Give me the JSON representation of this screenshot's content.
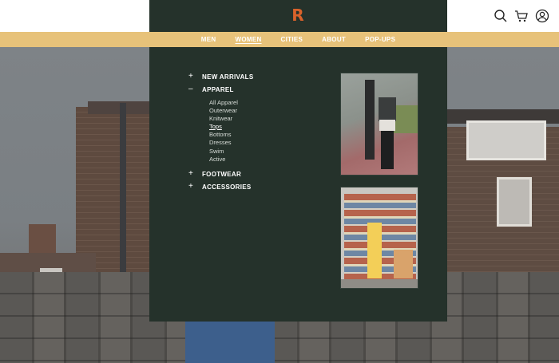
{
  "brand": {
    "logo_letter": "R",
    "logo_color": "#d9622b"
  },
  "header": {
    "icons": [
      "search-icon",
      "cart-icon",
      "account-icon"
    ]
  },
  "nav": {
    "items": [
      {
        "label": "MEN"
      },
      {
        "label": "WOMEN",
        "active": true
      },
      {
        "label": "CITIES"
      },
      {
        "label": "ABOUT"
      },
      {
        "label": "POP-UPS"
      }
    ]
  },
  "menu": {
    "categories": [
      {
        "sign": "+",
        "label": "NEW ARRIVALS"
      },
      {
        "sign": "–",
        "label": "APPAREL",
        "expanded": true,
        "subitems": [
          "All Apparel",
          "Outerwear",
          "Knitwear",
          "Tops",
          "Bottoms",
          "Dresses",
          "Swim",
          "Active"
        ],
        "active_subitem": "Tops"
      },
      {
        "sign": "+",
        "label": "FOOTWEAR"
      },
      {
        "sign": "+",
        "label": "ACCESSORIES"
      }
    ]
  },
  "colors": {
    "nav_bar": "#e7c27a",
    "menu_bg": "#25322b"
  }
}
